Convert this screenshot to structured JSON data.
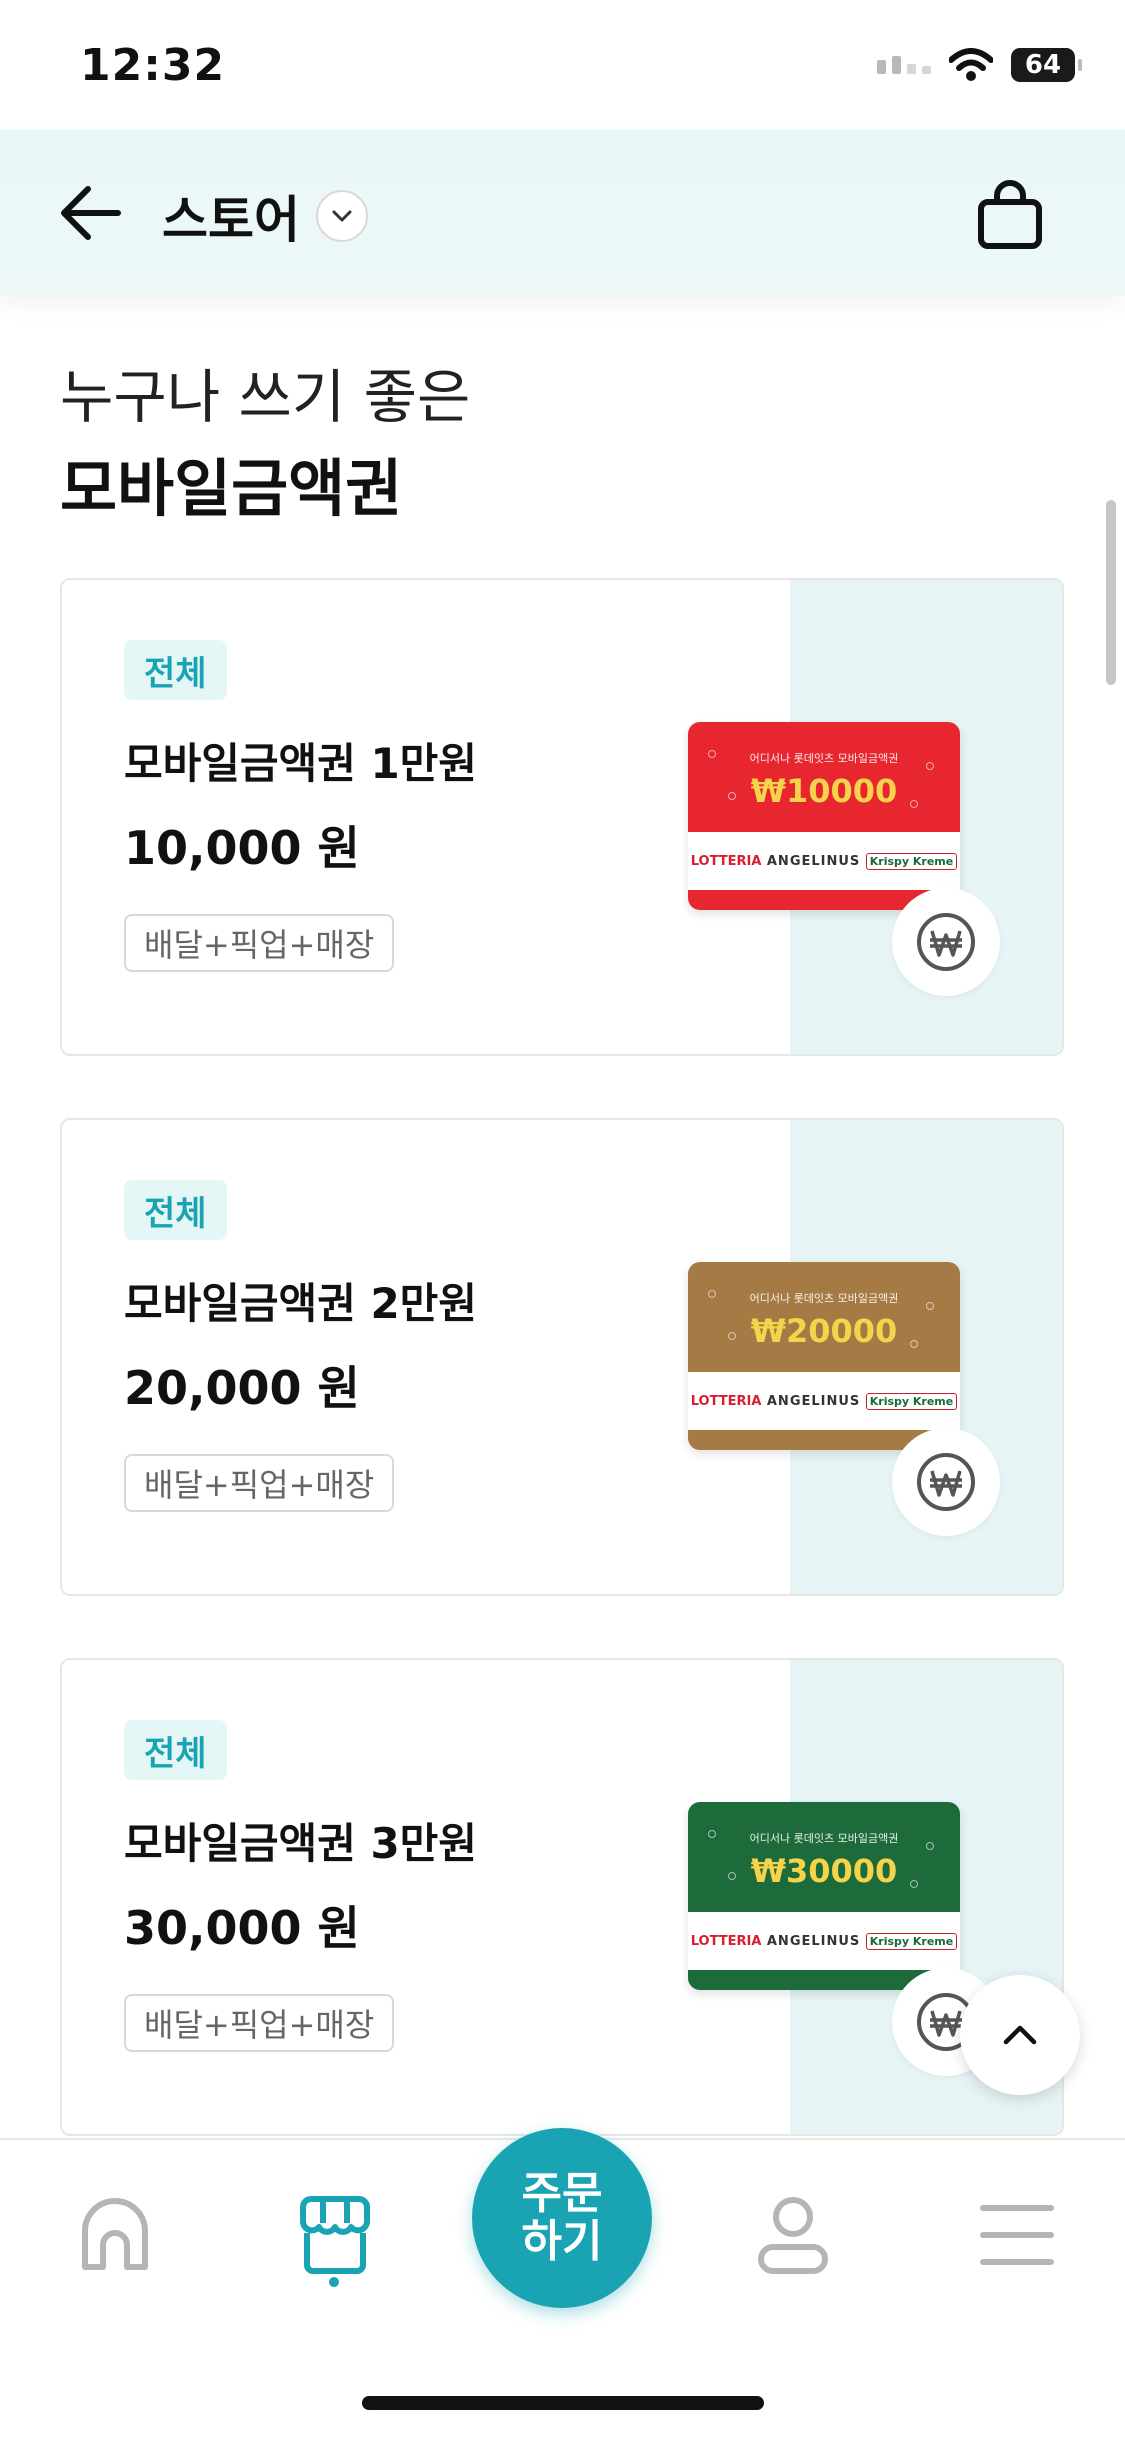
{
  "status_bar": {
    "time": "12:32",
    "battery": "64"
  },
  "header": {
    "title": "스토어"
  },
  "heading": {
    "line1": "누구나 쓰기 좋은",
    "line2": "모바일금액권"
  },
  "products": [
    {
      "badge": "전체",
      "name": "모바일금액권 1만원",
      "price": "10,000 원",
      "tag": "배달+픽업+매장",
      "card": {
        "brand_line": "어디서나 롯데잇츠 모바일금액권",
        "amount": "₩10000",
        "color": "#e8262f",
        "logos": [
          "LOTTERIA",
          "ANGELINUS",
          "Krispy Kreme"
        ]
      }
    },
    {
      "badge": "전체",
      "name": "모바일금액권 2만원",
      "price": "20,000 원",
      "tag": "배달+픽업+매장",
      "card": {
        "brand_line": "어디서나 롯데잇츠 모바일금액권",
        "amount": "₩20000",
        "color": "#a67a44",
        "logos": [
          "LOTTERIA",
          "ANGELINUS",
          "Krispy Kreme"
        ]
      }
    },
    {
      "badge": "전체",
      "name": "모바일금액권 3만원",
      "price": "30,000 원",
      "tag": "배달+픽업+매장",
      "card": {
        "brand_line": "어디서나 롯데잇츠 모바일금액권",
        "amount": "₩30000",
        "color": "#1d6b3a",
        "logos": [
          "LOTTERIA",
          "ANGELINUS",
          "Krispy Kreme"
        ]
      }
    }
  ],
  "bottom_nav": {
    "order_label": "주문\n하기",
    "order_line1": "주문",
    "order_line2": "하기",
    "items": [
      "home-icon",
      "store-icon",
      "profile-icon",
      "menu-icon"
    ],
    "active": "store-icon"
  },
  "colors": {
    "accent": "#1aa4b3",
    "header_bg": "#e9f6f7",
    "badge_bg": "#e5f6f7",
    "card_tint": "#e6f4f5"
  }
}
